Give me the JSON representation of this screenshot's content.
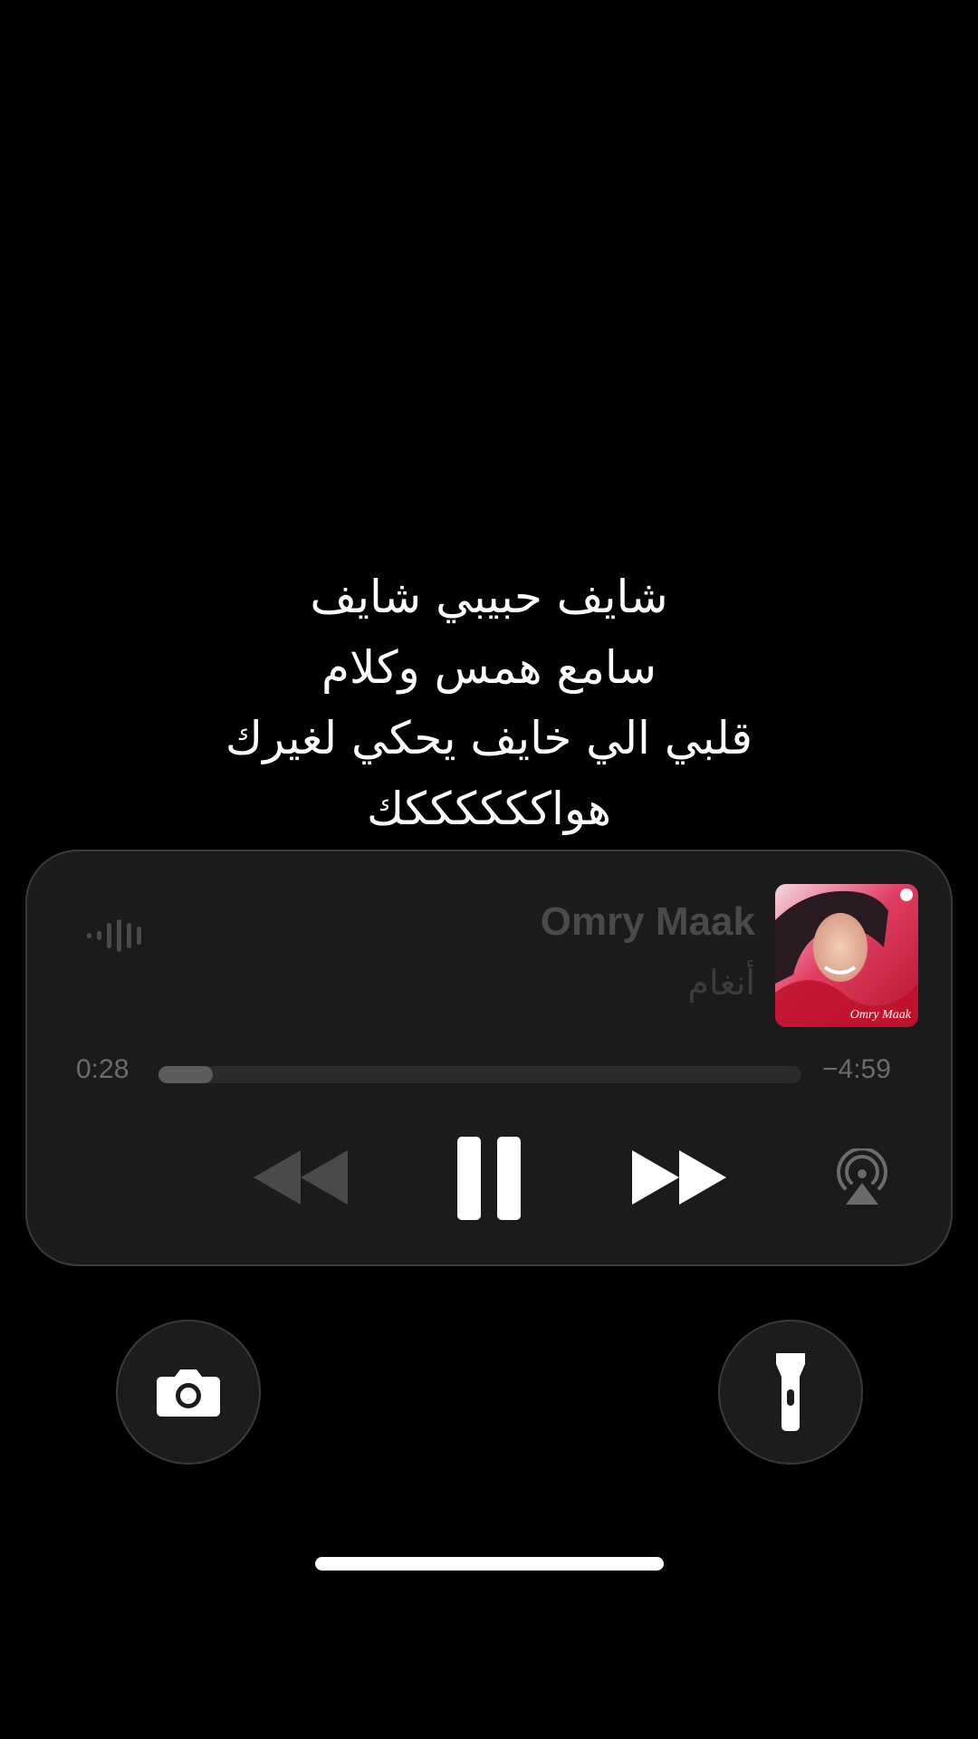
{
  "lyrics": {
    "lines": [
      "شايف حبيبي شايف",
      "سامع همس وكلام",
      "قلبي الي خايف يحكي لغيرك",
      "هواككككككك"
    ]
  },
  "now_playing": {
    "title": "Omry Maak",
    "artist": "أنغام",
    "album_art_text": "Omry Maak",
    "time_elapsed": "0:28",
    "time_remaining": "−4:59",
    "progress_fraction": 0.085,
    "state": "playing",
    "controls": {
      "rewind_icon": "rewind-icon",
      "pause_icon": "pause-icon",
      "forward_icon": "fast-forward-icon",
      "airplay_icon": "airplay-icon",
      "waveform_icon": "audio-waveform-icon"
    }
  },
  "quick_actions": {
    "left_icon": "camera-icon",
    "right_icon": "flashlight-icon"
  },
  "colors": {
    "background": "#000000",
    "widget": "#1b1b1c",
    "title_dim": "#4a4a4c",
    "accent": "#ffffff"
  }
}
